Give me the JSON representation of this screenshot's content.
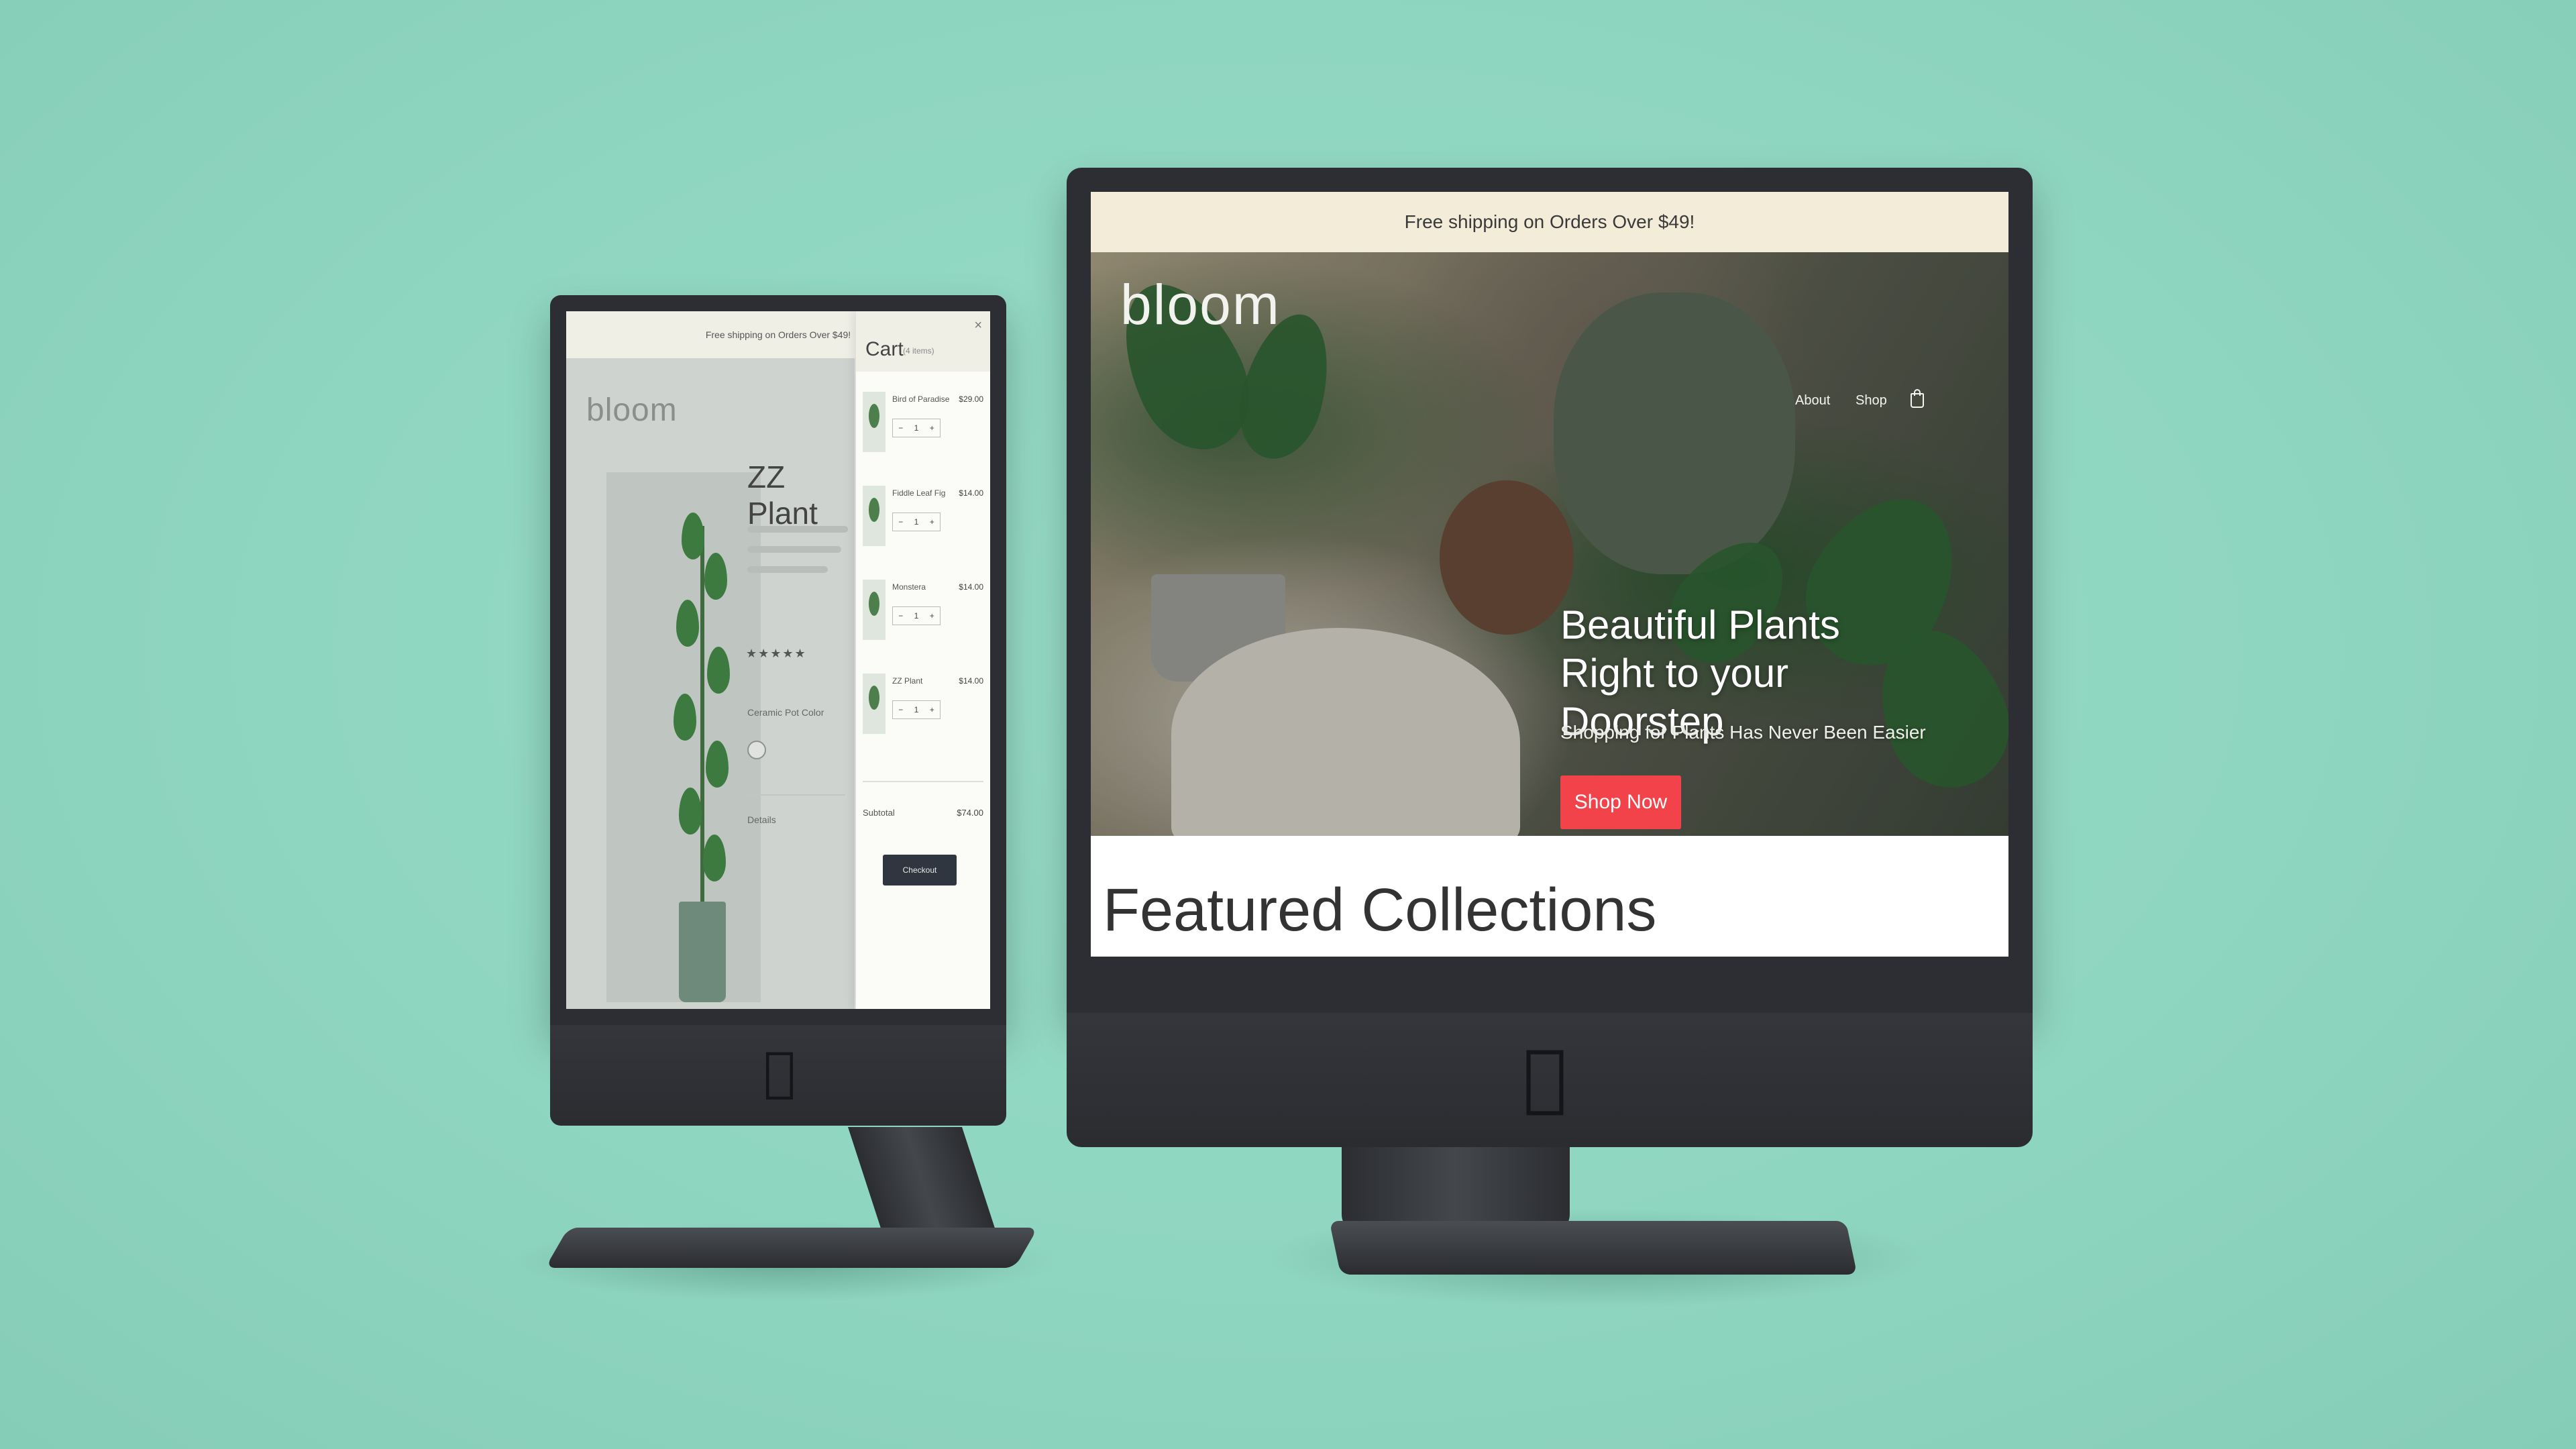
{
  "left_monitor": {
    "announcement": "Free shipping on Orders Over $49!",
    "logo": "bloom",
    "product": {
      "title": "ZZ Plant",
      "rating_stars": "★★★★★",
      "color_label": "Ceramic Pot Color",
      "details_label": "Details"
    },
    "cart": {
      "title": "Cart",
      "subtitle": "(4 items)",
      "close_icon": "×",
      "items": [
        {
          "name": "Bird of Paradise",
          "price": "$29.00",
          "qty": "1"
        },
        {
          "name": "Fiddle Leaf Fig",
          "price": "$14.00",
          "qty": "1"
        },
        {
          "name": "Monstera",
          "price": "$14.00",
          "qty": "1"
        },
        {
          "name": "ZZ Plant",
          "price": "$14.00",
          "qty": "1"
        }
      ],
      "subtotal_label": "Subtotal",
      "subtotal_value": "$74.00",
      "checkout_label": "Checkout"
    }
  },
  "right_monitor": {
    "announcement": "Free shipping on Orders Over $49!",
    "logo": "bloom",
    "nav": {
      "about": "About",
      "shop": "Shop"
    },
    "hero": {
      "heading_line1": "Beautiful Plants",
      "heading_line2": "Right to your Doorstep",
      "subheading": "Shopping for Plants Has Never Been Easier",
      "cta": "Shop Now"
    },
    "featured_title": "Featured Collections"
  },
  "colors": {
    "background": "#8fd6c0",
    "accent_cta": "#f2434a",
    "announcement_bar": "#f2ecd9",
    "bezel": "#2c2e33"
  },
  "icons": {
    "cart": "shopping-bag-icon",
    "close": "close-icon",
    "brand": "apple-logo-icon"
  }
}
